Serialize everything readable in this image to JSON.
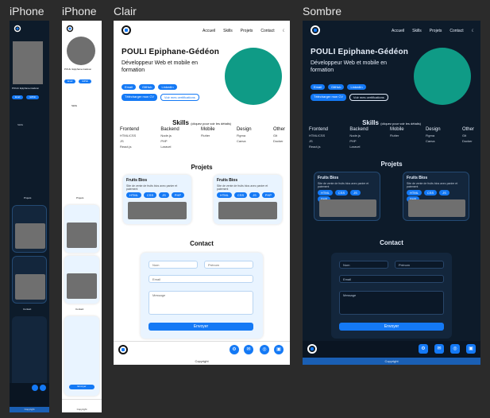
{
  "frames": {
    "iphone_dark_label": "iPhone",
    "iphone_light_label": "iPhone",
    "light_label": "Clair",
    "dark_label": "Sombre"
  },
  "site": {
    "name": "POULI Epiphane-Gédéon",
    "tagline": "Développeur Web et mobile en formation",
    "nav": [
      "Accueil",
      "Skills",
      "Projets",
      "Contact"
    ],
    "nav_toggle": "☾",
    "hero_buttons": [
      "Email",
      "GitHub",
      "LinkedIn"
    ],
    "hero_buttons_2": [
      "Télécharger mon CV",
      "Voir mes certifications"
    ],
    "skills_title": "Skills",
    "skills_subtitle": "(cliquez pour voir les détails)",
    "skill_columns": [
      {
        "h": "Frontend",
        "items": [
          "HTML/CSS",
          "JS",
          "React.js"
        ]
      },
      {
        "h": "Backend",
        "items": [
          "Node.js",
          "PHP",
          "Laravel"
        ]
      },
      {
        "h": "Mobile",
        "items": [
          "Flutter"
        ]
      },
      {
        "h": "Design",
        "items": [
          "Figma",
          "Canva"
        ]
      },
      {
        "h": "Other",
        "items": [
          "Git",
          "Docker"
        ]
      }
    ],
    "projects_title": "Projets",
    "projects": [
      {
        "title": "Fruits Bios",
        "desc": "Site de vente de fruits bios avec panier et paiement",
        "tags": [
          "HTML",
          "CSS",
          "JS",
          "PHP"
        ]
      },
      {
        "title": "Fruits Bios",
        "desc": "Site de vente de fruits bios avec panier et paiement",
        "tags": [
          "HTML",
          "CSS",
          "JS",
          "PHP"
        ]
      }
    ],
    "contact_title": "Contact",
    "form": {
      "first_name": "Nom",
      "last_name": "Prénom",
      "email": "Email",
      "message": "Message",
      "send": "Envoyer"
    },
    "footer_icons": [
      "⚙",
      "✉",
      "◎",
      "▣"
    ],
    "copyright": "Copyright"
  },
  "colors": {
    "accent": "#1479f5",
    "avatar_teal": "#0f9b86",
    "dark_bg": "#0d1b2a"
  }
}
